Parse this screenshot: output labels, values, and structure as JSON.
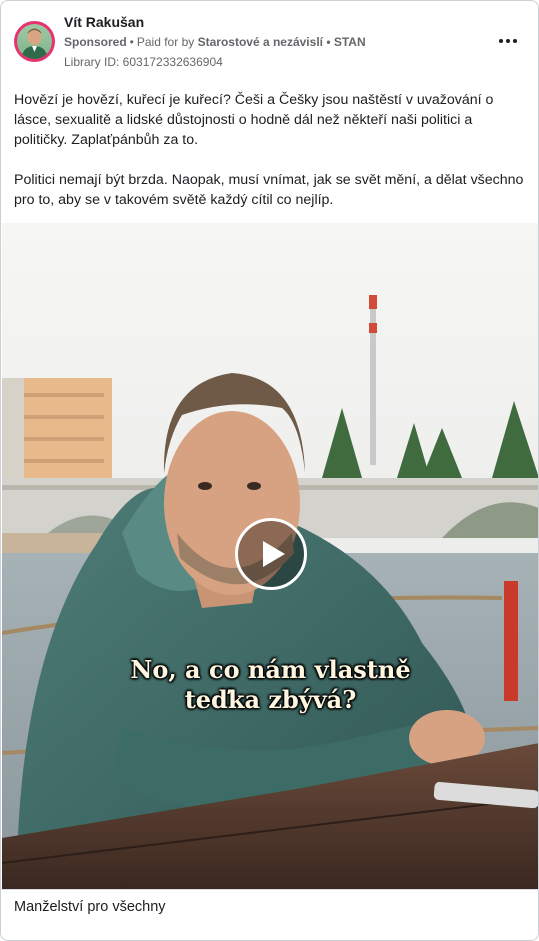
{
  "post": {
    "author": "Vít Rakušan",
    "sponsored_label": "Sponsored",
    "paid_for_prefix": "Paid for by",
    "payer": "Starostové a nezávislí • STAN",
    "library_id": "Library ID: 603172332636904",
    "more_icon": "more-options-icon",
    "paragraphs": [
      "Hovězí je hovězí, kuřecí je kuřecí? Češi a Češky jsou naštěstí v uvažování o lásce, sexualitě a lidské důstojnosti o hodně dál než někteří naši politici a političky. Zaplaťpánbůh za to.",
      "Politici nemají být brzda. Naopak, musí vnímat, jak se svět mění, a dělat všechno pro to, aby se v takovém světě každý cítil co nejlíp."
    ]
  },
  "video": {
    "caption_line1": "No, a co nám vlastně",
    "caption_line2": "teďka zbývá?",
    "play_icon": "play-icon"
  },
  "footer": {
    "title": "Manželství pro všechny"
  },
  "colors": {
    "avatar_ring": "#e6336f",
    "text_primary": "#1c1e21",
    "text_secondary": "#65676b"
  }
}
